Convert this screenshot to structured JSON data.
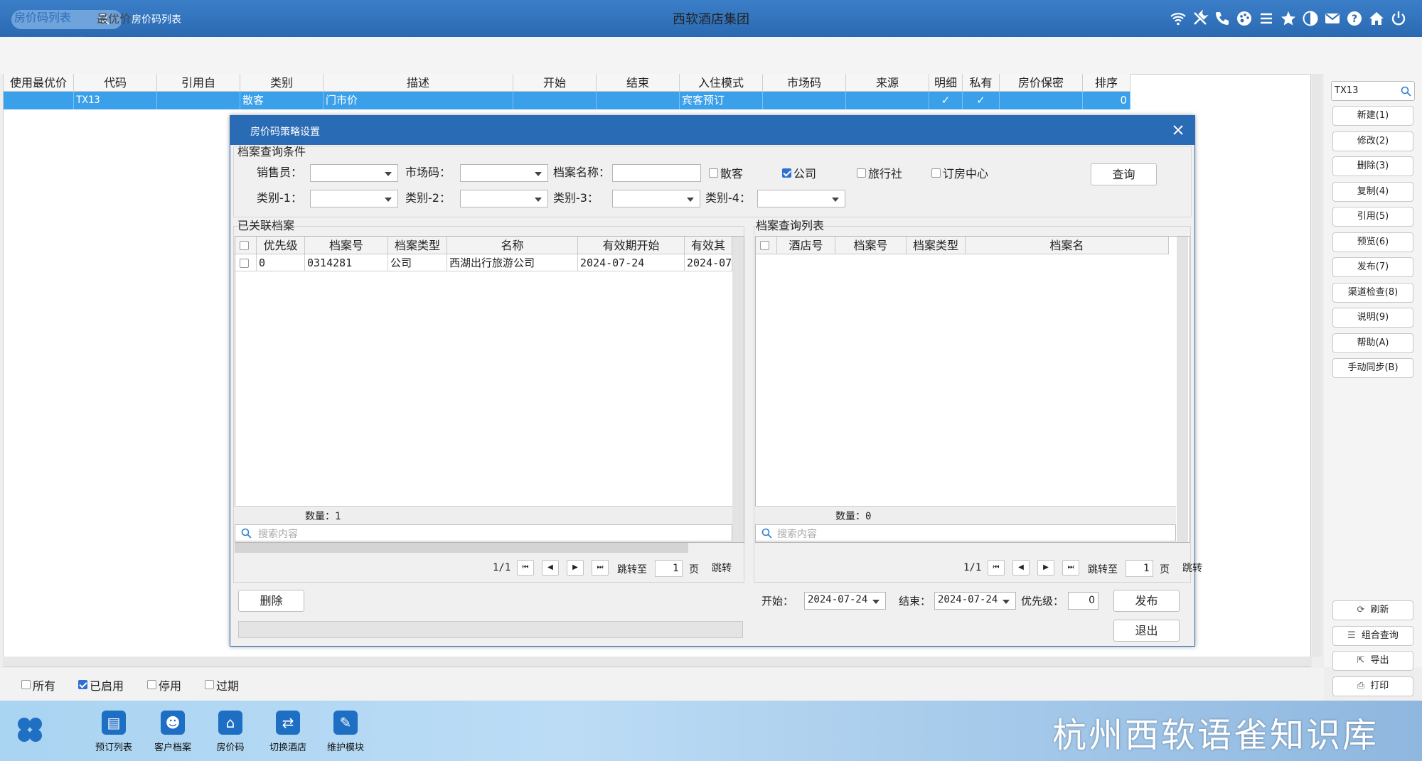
{
  "topbar": {
    "module_title": "房价码列表",
    "app_title": "西软酒店集团",
    "icons": [
      "wifi-icon",
      "tools-icon",
      "phone-icon",
      "palette-icon",
      "menu-icon",
      "star-icon",
      "theme-icon",
      "mail-icon",
      "help-icon",
      "home-icon",
      "power-icon"
    ]
  },
  "tabs": [
    {
      "label": "房价码列表",
      "active": true
    },
    {
      "label": "最优价",
      "active": false
    }
  ],
  "main_table": {
    "columns": [
      "使用最优价",
      "代码",
      "引用自",
      "类别",
      "描述",
      "开始",
      "结束",
      "入住模式",
      "市场码",
      "来源",
      "明细",
      "私有",
      "房价保密",
      "排序"
    ],
    "rows": [
      {
        "use_best": "",
        "code": "TX13",
        "ref": "",
        "category": "散客",
        "desc": "门市价",
        "start": "",
        "end": "",
        "mode": "宾客预订",
        "market": "",
        "source": "",
        "detail": "✓",
        "private": "✓",
        "secret": "",
        "order": "0"
      }
    ]
  },
  "right_panel": {
    "search_value": "TX13",
    "buttons": [
      "新建(1)",
      "修改(2)",
      "删除(3)",
      "复制(4)",
      "引用(5)",
      "预览(6)",
      "发布(7)",
      "渠道检查(8)",
      "说明(9)",
      "帮助(A)",
      "手动同步(B)"
    ],
    "bottom_buttons": [
      "刷新",
      "组合查询",
      "导出",
      "打印"
    ]
  },
  "filters": [
    {
      "label": "所有",
      "checked": false
    },
    {
      "label": "已启用",
      "checked": true
    },
    {
      "label": "停用",
      "checked": false
    },
    {
      "label": "过期",
      "checked": false
    }
  ],
  "taskbar": {
    "items": [
      "预订列表",
      "客户档案",
      "房价码",
      "切换酒店",
      "维护模块"
    ],
    "watermark": "杭州西软语雀知识库"
  },
  "dialog": {
    "title": "房价码策略设置",
    "query_section": "档案查询条件",
    "labels": {
      "salesperson": "销售员：",
      "market_code": "市场码：",
      "profile_name": "档案名称：",
      "cat1": "类别-1：",
      "cat2": "类别-2：",
      "cat3": "类别-3：",
      "cat4": "类别-4："
    },
    "type_checks": [
      {
        "label": "散客",
        "checked": false
      },
      {
        "label": "公司",
        "checked": true
      },
      {
        "label": "旅行社",
        "checked": false
      },
      {
        "label": "订房中心",
        "checked": false
      }
    ],
    "query_button": "查询",
    "linked": {
      "title": "已关联档案",
      "columns": [
        "优先级",
        "档案号",
        "档案类型",
        "名称",
        "有效期开始",
        "有效其"
      ],
      "rows": [
        {
          "priority": "0",
          "no": "0314281",
          "type": "公司",
          "name": "西湖出行旅游公司",
          "start": "2024-07-24",
          "end": "2024-07-"
        }
      ],
      "count": "数量：1",
      "search_placeholder": "搜索内容",
      "page": "1/1",
      "jump_label": "跳转至",
      "page_input": "1",
      "page_unit": "页",
      "jump_button": "跳转"
    },
    "query_list": {
      "title": "档案查询列表",
      "columns": [
        "酒店号",
        "档案号",
        "档案类型",
        "档案名"
      ],
      "count": "数量：0",
      "search_placeholder": "搜索内容",
      "page": "1/1",
      "jump_label": "跳转至",
      "page_input": "1",
      "page_unit": "页",
      "jump_button": "跳转"
    },
    "delete_button": "删除",
    "start_label": "开始：",
    "start_date": "2024-07-24",
    "end_label": "结束：",
    "end_date": "2024-07-24",
    "priority_label": "优先级：",
    "priority_value": "0",
    "publish_button": "发布",
    "exit_button": "退出"
  },
  "colors": {
    "accent": "#2a69b2",
    "selected_row": "#3aa0ea",
    "checkbox": "#2d6fd3"
  }
}
